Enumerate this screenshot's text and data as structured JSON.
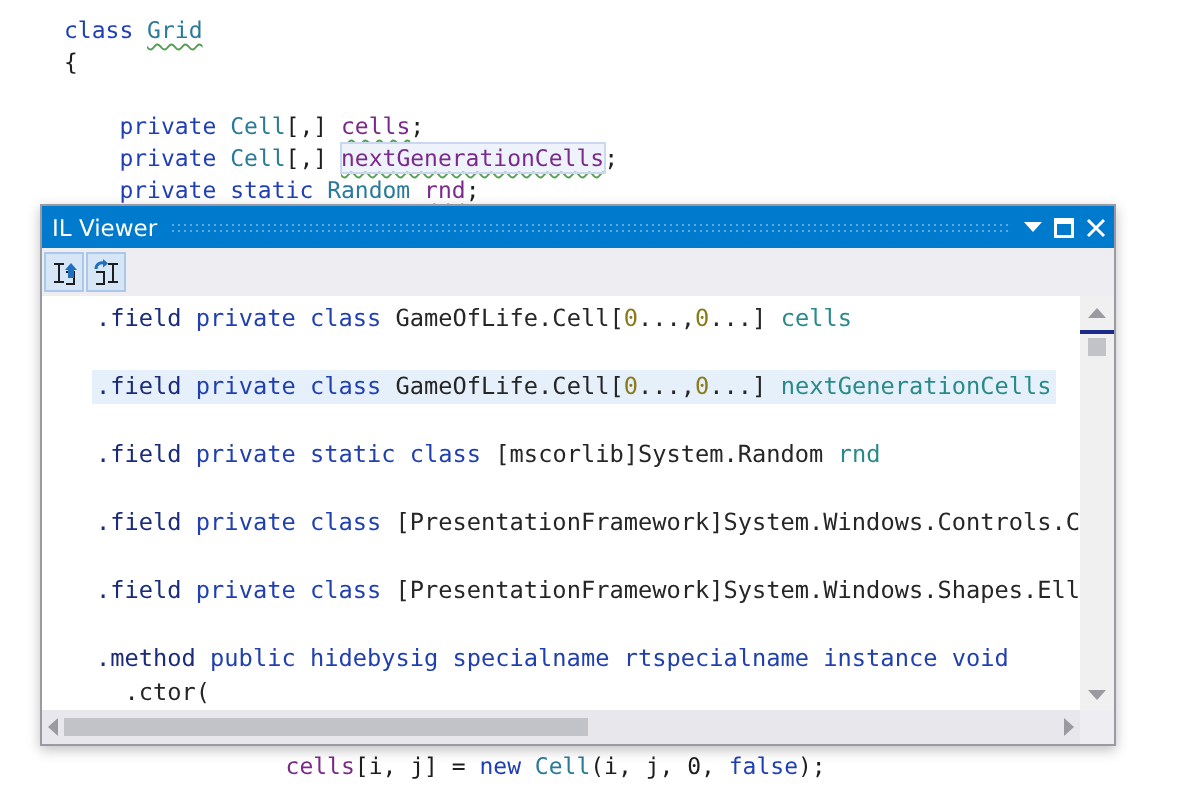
{
  "editor": {
    "top_blocks": [
      [
        {
          "parts": [
            {
              "text": "class ",
              "kind": "keyword",
              "squiggle": false,
              "highlighted": false
            },
            {
              "text": "Grid",
              "kind": "type",
              "squiggle": true,
              "highlighted": false
            }
          ]
        },
        {
          "parts": [
            {
              "text": "{",
              "kind": "plain",
              "squiggle": false,
              "highlighted": false
            }
          ]
        }
      ],
      [
        {
          "parts": [
            {
              "text": "    private ",
              "kind": "keyword",
              "squiggle": false,
              "highlighted": false
            },
            {
              "text": "Cell",
              "kind": "type",
              "squiggle": false,
              "highlighted": false
            },
            {
              "text": "[,] ",
              "kind": "plain",
              "squiggle": false,
              "highlighted": false
            },
            {
              "text": "cells",
              "kind": "field",
              "squiggle": true,
              "highlighted": false
            },
            {
              "text": ";",
              "kind": "plain",
              "squiggle": false,
              "highlighted": false
            }
          ]
        },
        {
          "parts": [
            {
              "text": "    private ",
              "kind": "keyword",
              "squiggle": false,
              "highlighted": false
            },
            {
              "text": "Cell",
              "kind": "type",
              "squiggle": false,
              "highlighted": false
            },
            {
              "text": "[,] ",
              "kind": "plain",
              "squiggle": false,
              "highlighted": false
            },
            {
              "text": "nextGenerationCells",
              "kind": "field",
              "squiggle": true,
              "highlighted": true
            },
            {
              "text": ";",
              "kind": "plain",
              "squiggle": false,
              "highlighted": false
            }
          ]
        },
        {
          "parts": [
            {
              "text": "    private static ",
              "kind": "keyword",
              "squiggle": false,
              "highlighted": false
            },
            {
              "text": "Random ",
              "kind": "type",
              "squiggle": false,
              "highlighted": false
            },
            {
              "text": "rnd",
              "kind": "field",
              "squiggle": true,
              "highlighted": false
            },
            {
              "text": ";",
              "kind": "plain",
              "squiggle": false,
              "highlighted": false
            }
          ]
        }
      ]
    ],
    "bottom_blocks": [
      [
        {
          "parts": [
            {
              "text": "                cells",
              "kind": "field",
              "squiggle": false,
              "highlighted": false
            },
            {
              "text": "[i, j] = ",
              "kind": "plain",
              "squiggle": false,
              "highlighted": false
            },
            {
              "text": "new ",
              "kind": "keyword",
              "squiggle": false,
              "highlighted": false
            },
            {
              "text": "Cell",
              "kind": "type",
              "squiggle": false,
              "highlighted": false
            },
            {
              "text": "(i, j, 0, ",
              "kind": "plain",
              "squiggle": false,
              "highlighted": false
            },
            {
              "text": "false",
              "kind": "keyword",
              "squiggle": false,
              "highlighted": false
            },
            {
              "text": ");",
              "kind": "plain",
              "squiggle": false,
              "highlighted": false
            }
          ]
        }
      ]
    ]
  },
  "il_viewer": {
    "title": "IL Viewer",
    "blocks": [
      [
        {
          "selected": false,
          "parts": [
            {
              "text": ".field ",
              "kind": "directive"
            },
            {
              "text": "private class ",
              "kind": "keyword"
            },
            {
              "text": "GameOfLife.Cell[",
              "kind": "plain"
            },
            {
              "text": "0",
              "kind": "number"
            },
            {
              "text": "...,",
              "kind": "plain"
            },
            {
              "text": "0",
              "kind": "number"
            },
            {
              "text": "...] ",
              "kind": "plain"
            },
            {
              "text": "cells",
              "kind": "name"
            }
          ]
        }
      ],
      [
        {
          "selected": true,
          "parts": [
            {
              "text": ".field ",
              "kind": "directive"
            },
            {
              "text": "private class ",
              "kind": "keyword"
            },
            {
              "text": "GameOfLife.Cell[",
              "kind": "plain"
            },
            {
              "text": "0",
              "kind": "number"
            },
            {
              "text": "...,",
              "kind": "plain"
            },
            {
              "text": "0",
              "kind": "number"
            },
            {
              "text": "...] ",
              "kind": "plain"
            },
            {
              "text": "nextGenerationCells",
              "kind": "name"
            }
          ]
        }
      ],
      [
        {
          "selected": false,
          "parts": [
            {
              "text": ".field ",
              "kind": "directive"
            },
            {
              "text": "private static class ",
              "kind": "keyword"
            },
            {
              "text": "[mscorlib]System.Random ",
              "kind": "plain"
            },
            {
              "text": "rnd",
              "kind": "name"
            }
          ]
        }
      ],
      [
        {
          "selected": false,
          "parts": [
            {
              "text": ".field ",
              "kind": "directive"
            },
            {
              "text": "private class ",
              "kind": "keyword"
            },
            {
              "text": "[PresentationFramework]System.Windows.Controls.C",
              "kind": "plain"
            }
          ]
        }
      ],
      [
        {
          "selected": false,
          "parts": [
            {
              "text": ".field ",
              "kind": "directive"
            },
            {
              "text": "private class ",
              "kind": "keyword"
            },
            {
              "text": "[PresentationFramework]System.Windows.Shapes.Ell",
              "kind": "plain"
            }
          ]
        }
      ],
      [
        {
          "selected": false,
          "parts": [
            {
              "text": ".method ",
              "kind": "directive"
            },
            {
              "text": "public hidebysig specialname rtspecialname instance void",
              "kind": "keyword"
            }
          ]
        },
        {
          "selected": false,
          "parts": [
            {
              "text": "  .ctor(",
              "kind": "plain"
            }
          ]
        }
      ]
    ]
  }
}
